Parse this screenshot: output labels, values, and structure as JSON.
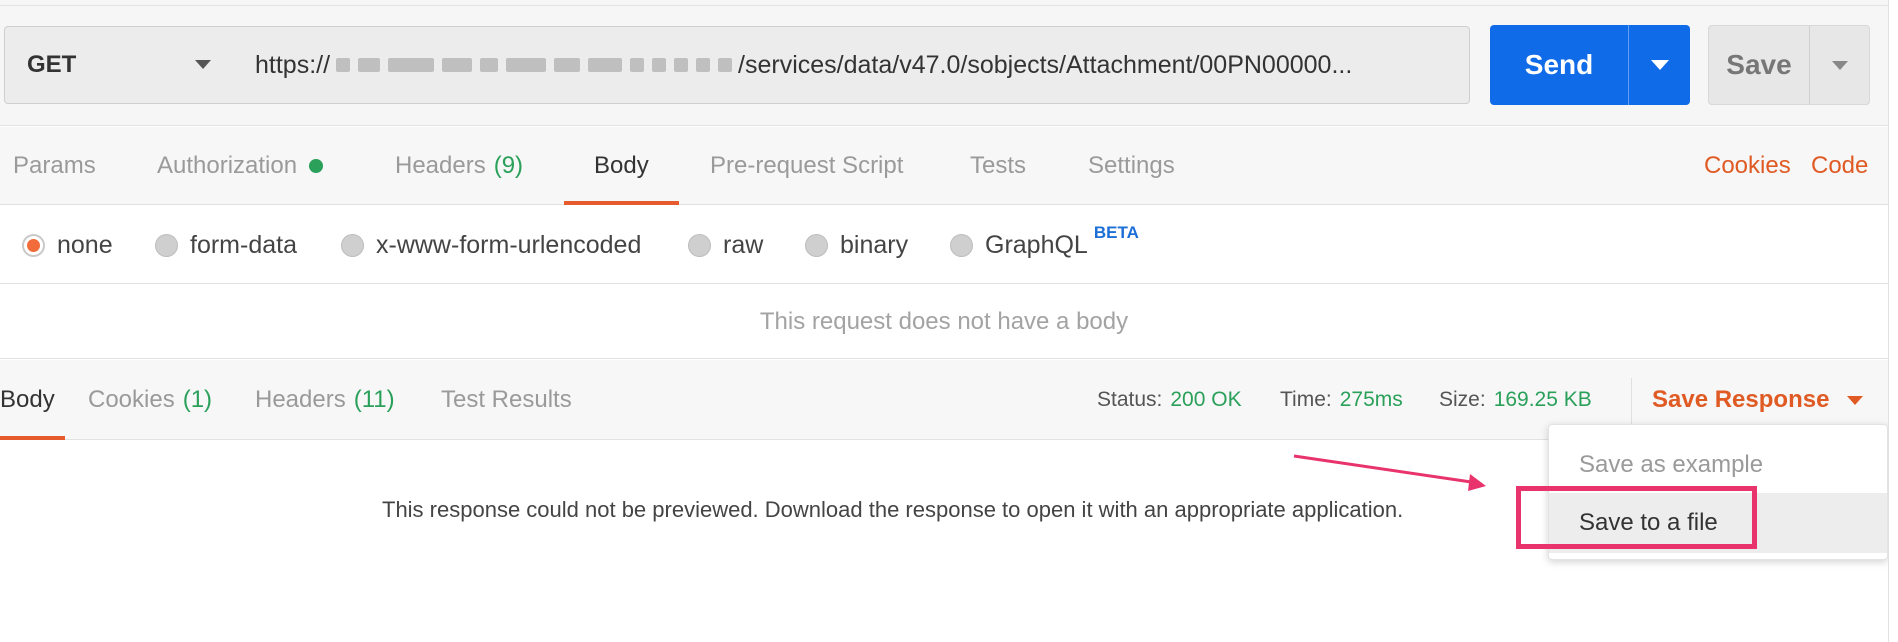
{
  "request": {
    "method": "GET",
    "url_prefix": "https://",
    "url_suffix": "/services/data/v47.0/sobjects/Attachment/00PN00000...",
    "send_label": "Send",
    "save_label": "Save"
  },
  "request_tabs": {
    "params": "Params",
    "authorization": "Authorization",
    "headers": "Headers",
    "headers_count": "(9)",
    "body": "Body",
    "prerequest": "Pre-request Script",
    "tests": "Tests",
    "settings": "Settings",
    "cookies_link": "Cookies",
    "code_link": "Code"
  },
  "body_types": {
    "none": "none",
    "form_data": "form-data",
    "urlencoded": "x-www-form-urlencoded",
    "raw": "raw",
    "binary": "binary",
    "graphql": "GraphQL",
    "beta": "BETA",
    "selected": "none"
  },
  "no_body_message": "This request does not have a body",
  "response": {
    "tabs": {
      "body": "Body",
      "cookies": "Cookies",
      "cookies_count": "(1)",
      "headers": "Headers",
      "headers_count": "(11)",
      "test_results": "Test Results"
    },
    "status_label": "Status:",
    "status_value": "200 OK",
    "time_label": "Time:",
    "time_value": "275ms",
    "size_label": "Size:",
    "size_value": "169.25 KB",
    "save_response": "Save Response",
    "message": "This response could not be previewed. Download the response to open it with an appropriate application."
  },
  "save_menu": {
    "save_as_example": "Save as example",
    "save_to_file": "Save to a file"
  },
  "colors": {
    "accent": "#e05a24",
    "send_blue": "#0f6be8",
    "success_green": "#2aa05a",
    "annotation_pink": "#e8336d"
  }
}
